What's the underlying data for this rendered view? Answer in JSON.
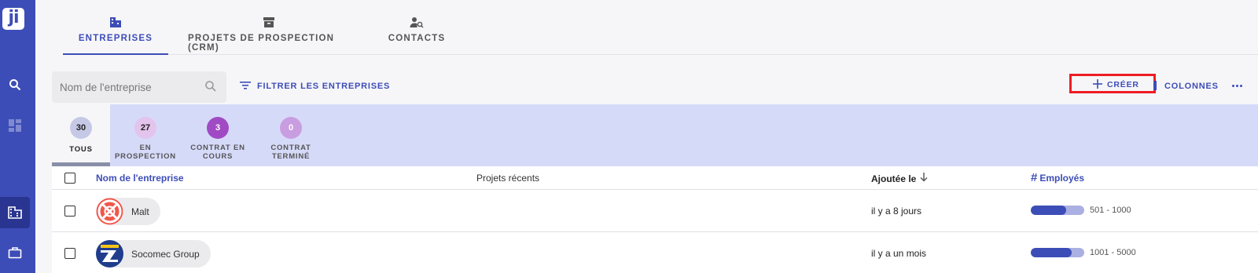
{
  "sidebar": {
    "logo_text": "ji",
    "icons": [
      "search-icon",
      "dashboard-icon",
      "building-icon",
      "briefcase-icon"
    ]
  },
  "tabs": [
    {
      "label": "ENTREPRISES",
      "icon": "building-icon",
      "active": true
    },
    {
      "label": "PROJETS DE PROSPECTION (CRM)",
      "icon": "archive-icon",
      "active": false
    },
    {
      "label": "CONTACTS",
      "icon": "person-search-icon",
      "active": false
    }
  ],
  "toolbar": {
    "search_placeholder": "Nom de l'entreprise",
    "filter_label": "FILTRER LES ENTREPRISES",
    "create_label": "CRÉER",
    "columns_label": "COLONNES"
  },
  "statuses": [
    {
      "count": "30",
      "label": "TOUS",
      "pill_bg": "#c5c9e6",
      "pill_fg": "#222222"
    },
    {
      "count": "27",
      "label": "EN PROSPECTION",
      "pill_bg": "#e3c4ec",
      "pill_fg": "#222222"
    },
    {
      "count": "3",
      "label": "CONTRAT EN COURS",
      "pill_bg": "#a04bc4",
      "pill_fg": "#ffffff"
    },
    {
      "count": "0",
      "label": "CONTRAT TERMINÉ",
      "pill_bg": "#c99ee0",
      "pill_fg": "#ffffff"
    }
  ],
  "table": {
    "columns": {
      "name": "Nom de l'entreprise",
      "projects": "Projets récents",
      "added": "Ajoutée le",
      "employees": "Employés"
    },
    "rows": [
      {
        "name": "Malt",
        "added": "il y a 8 jours",
        "employees": "501 - 1000",
        "employee_level": 0.66
      },
      {
        "name": "Socomec Group",
        "added": "il y a un mois",
        "employees": "1001 - 5000",
        "employee_level": 0.76
      }
    ]
  },
  "colors": {
    "accent": "#3d4db7",
    "highlight": "#ee1c24",
    "band": "#d6daf9"
  }
}
